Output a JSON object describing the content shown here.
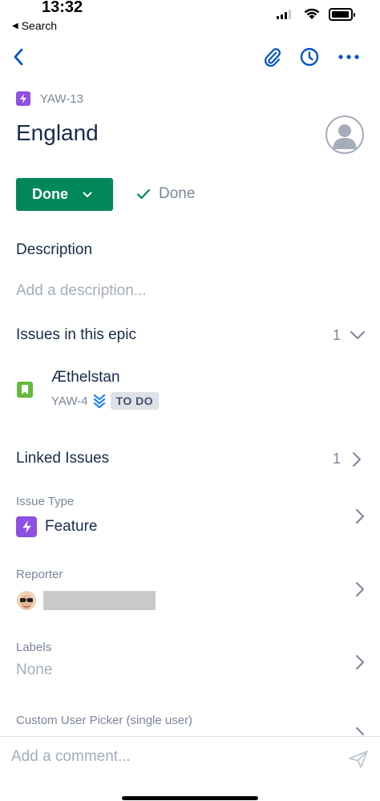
{
  "status_bar": {
    "time": "13:32",
    "back_label": "Search"
  },
  "issue": {
    "key": "YAW-13",
    "type_icon": "lightning-icon",
    "title": "England",
    "assignee_icon": "unassigned-avatar-icon",
    "status_label": "Done",
    "transition_label": "Done"
  },
  "description": {
    "heading": "Description",
    "placeholder": "Add a description..."
  },
  "epic_issues": {
    "heading": "Issues in this epic",
    "count": "1",
    "items": [
      {
        "title": "Æthelstan",
        "key": "YAW-4",
        "status": "TO DO",
        "type_icon": "story-bookmark-icon",
        "priority_icon": "lowest-priority-icon"
      }
    ]
  },
  "linked_issues": {
    "heading": "Linked Issues",
    "count": "1"
  },
  "fields": {
    "issue_type_label": "Issue Type",
    "issue_type_value": "Feature",
    "reporter_label": "Reporter",
    "labels_label": "Labels",
    "labels_value": "None",
    "custom_picker_label": "Custom User Picker (single user)"
  },
  "comment": {
    "placeholder": "Add a comment..."
  },
  "colors": {
    "accent": "#0052CC",
    "done_green": "#00875A",
    "epic_purple": "#904EE2",
    "story_green": "#63BA3C"
  }
}
